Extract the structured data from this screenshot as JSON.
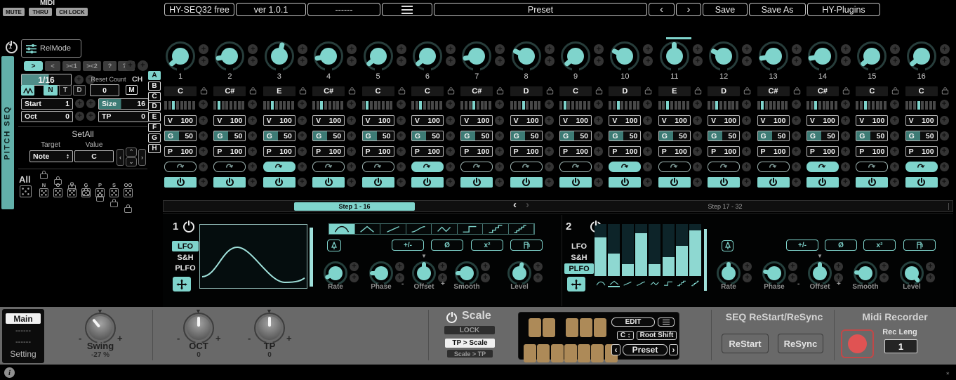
{
  "colors": {
    "accent": "#7fd4cc",
    "accent_dim": "#3d7b75",
    "record_red": "#e05353",
    "key_tan": "#ad8a58"
  },
  "top_bar": {
    "midi": "MIDI",
    "mute": "MUTE",
    "thru": "THRU",
    "ch_lock": "CH LOCK",
    "title": "HY-SEQ32 free",
    "version": "ver 1.0.1",
    "slot": "------",
    "preset": "Preset",
    "prev": "‹",
    "next": "›",
    "save": "Save",
    "save_as": "Save As",
    "brand": "HY-Plugins"
  },
  "left_panel": {
    "power_number": "1",
    "relmode": "RelMode",
    "play_modes": {
      "fwd": ">",
      "bwd": "<",
      "pp1": "><1",
      "pp2": "><2",
      "rand": "?",
      "rand2": "??",
      "active": ">"
    },
    "rate": "1/16",
    "reset_count_label": "Reset Count",
    "reset_count": "0",
    "ch_label": "CH",
    "ch_value": "M",
    "note_len_modes": [
      "N",
      "T",
      "D"
    ],
    "active_note_len": "N",
    "start_label": "Start",
    "start": "1",
    "size_label": "Size",
    "size": "16",
    "oct_label": "Oct",
    "oct": "0",
    "tp_label": "TP",
    "tp": "0",
    "setall_title": "SetAll",
    "target_label": "Target",
    "target": "Note",
    "value_label": "Value",
    "value": "C",
    "all_label": "All",
    "lanes": [
      "N",
      "O",
      "V",
      "G",
      "P",
      "S",
      "OO"
    ],
    "side_label": "PITCH SEQ"
  },
  "pattern_tabs": {
    "items": [
      "A",
      "B",
      "C",
      "D",
      "E",
      "F",
      "G",
      "H"
    ],
    "active": "A"
  },
  "sequencer": {
    "v_label": "V",
    "g_label": "G",
    "p_label": "P",
    "current_step": 11,
    "page_current": "Step  1 - 16",
    "page_next": "Step  17 - 32",
    "prev": "‹",
    "next": "›",
    "steps": [
      {
        "n": "1",
        "note": "C",
        "bar": 2,
        "v": "100",
        "g": "50",
        "p": "100",
        "slide": false,
        "on": true,
        "angle": -130,
        "current": false
      },
      {
        "n": "2",
        "note": "C#",
        "bar": 1,
        "v": "100",
        "g": "50",
        "p": "100",
        "slide": false,
        "on": true,
        "angle": -100,
        "current": false
      },
      {
        "n": "3",
        "note": "E",
        "bar": 2,
        "v": "100",
        "g": "50",
        "p": "100",
        "slide": true,
        "on": true,
        "angle": 15,
        "current": false
      },
      {
        "n": "4",
        "note": "C#",
        "bar": 2,
        "v": "100",
        "g": "50",
        "p": "100",
        "slide": false,
        "on": true,
        "angle": -100,
        "current": false
      },
      {
        "n": "5",
        "note": "C",
        "bar": 1,
        "v": "100",
        "g": "50",
        "p": "100",
        "slide": false,
        "on": true,
        "angle": -130,
        "current": false
      },
      {
        "n": "6",
        "note": "C",
        "bar": 2,
        "v": "100",
        "g": "50",
        "p": "100",
        "slide": true,
        "on": true,
        "angle": -130,
        "current": false
      },
      {
        "n": "7",
        "note": "C#",
        "bar": 3,
        "v": "100",
        "g": "50",
        "p": "100",
        "slide": false,
        "on": true,
        "angle": -100,
        "current": false
      },
      {
        "n": "8",
        "note": "D",
        "bar": 3,
        "v": "100",
        "g": "50",
        "p": "100",
        "slide": false,
        "on": true,
        "angle": -65,
        "current": false
      },
      {
        "n": "9",
        "note": "C",
        "bar": 1,
        "v": "100",
        "g": "50",
        "p": "100",
        "slide": false,
        "on": true,
        "angle": -130,
        "current": false
      },
      {
        "n": "10",
        "note": "D",
        "bar": 2,
        "v": "100",
        "g": "50",
        "p": "100",
        "slide": true,
        "on": true,
        "angle": -65,
        "current": false
      },
      {
        "n": "11",
        "note": "E",
        "bar": 2,
        "v": "100",
        "g": "50",
        "p": "100",
        "slide": false,
        "on": true,
        "angle": 0,
        "current": true
      },
      {
        "n": "12",
        "note": "D",
        "bar": 2,
        "v": "100",
        "g": "50",
        "p": "100",
        "slide": false,
        "on": true,
        "angle": -65,
        "current": false
      },
      {
        "n": "13",
        "note": "C#",
        "bar": 1,
        "v": "100",
        "g": "50",
        "p": "100",
        "slide": false,
        "on": true,
        "angle": -100,
        "current": false
      },
      {
        "n": "14",
        "note": "C#",
        "bar": 2,
        "v": "100",
        "g": "50",
        "p": "100",
        "slide": true,
        "on": true,
        "angle": -100,
        "current": false
      },
      {
        "n": "15",
        "note": "C",
        "bar": 2,
        "v": "100",
        "g": "50",
        "p": "100",
        "slide": false,
        "on": true,
        "angle": -130,
        "current": false
      },
      {
        "n": "16",
        "note": "C",
        "bar": 3,
        "v": "100",
        "g": "50",
        "p": "100",
        "slide": true,
        "on": true,
        "angle": -130,
        "current": false
      }
    ]
  },
  "lfo1": {
    "id": "1",
    "tabs": [
      "LFO",
      "S&H",
      "PLFO"
    ],
    "active_tab": "LFO",
    "waveform": "sine",
    "shapes": [
      "sine",
      "triangle",
      "ramp",
      "curve",
      "zigzag",
      "step",
      "stairs",
      "stairs-fine"
    ],
    "selected_shape": "sine",
    "ops": [
      "+/-",
      "Ø",
      "x²"
    ],
    "knobs": [
      "Rate",
      "Phase",
      "Offset",
      "Smooth",
      "Level"
    ],
    "knob_angles": [
      -115,
      -90,
      0,
      -90,
      15
    ],
    "minus": "-",
    "plus": "+"
  },
  "lfo2": {
    "id": "2",
    "tabs": [
      "LFO",
      "S&H",
      "PLFO"
    ],
    "active_tab": "PLFO",
    "selected_shape": "triangle",
    "bars": [
      0.77,
      0.45,
      0.24,
      0.85,
      0.24,
      0.37,
      0.6,
      0.9
    ],
    "ops": [
      "+/-",
      "Ø",
      "x²"
    ],
    "knobs": [
      "Rate",
      "Phase",
      "Offset",
      "Smooth",
      "Level"
    ],
    "knob_angles": [
      0,
      -80,
      0,
      -85,
      140
    ],
    "minus": "-",
    "plus": "+"
  },
  "bottom_bar": {
    "pages": [
      "Main",
      "------",
      "------",
      "Setting"
    ],
    "active_page": "Main",
    "swing": {
      "label": "Swing",
      "value": "-27 %",
      "angle": -40
    },
    "oct": {
      "label": "OCT",
      "value": "0",
      "angle": 0
    },
    "tp": {
      "label": "TP",
      "value": "0",
      "angle": 0
    },
    "minus": "-",
    "plus": "+",
    "scale": {
      "title": "Scale",
      "lock": "LOCK",
      "tp_to_scale": "TP > Scale",
      "scale_to_tp": "Scale > TP",
      "edit": "EDIT",
      "root": "C",
      "root_shift": "Root Shift",
      "preset": "Preset",
      "prev": "‹",
      "next": "›"
    },
    "restart_section": {
      "title": "SEQ ReStart/ReSync",
      "restart": "ReStart",
      "resync": "ReSync"
    },
    "recorder": {
      "title": "Midi Recorder",
      "rec_leng_label": "Rec Leng",
      "rec_leng": "1"
    }
  }
}
